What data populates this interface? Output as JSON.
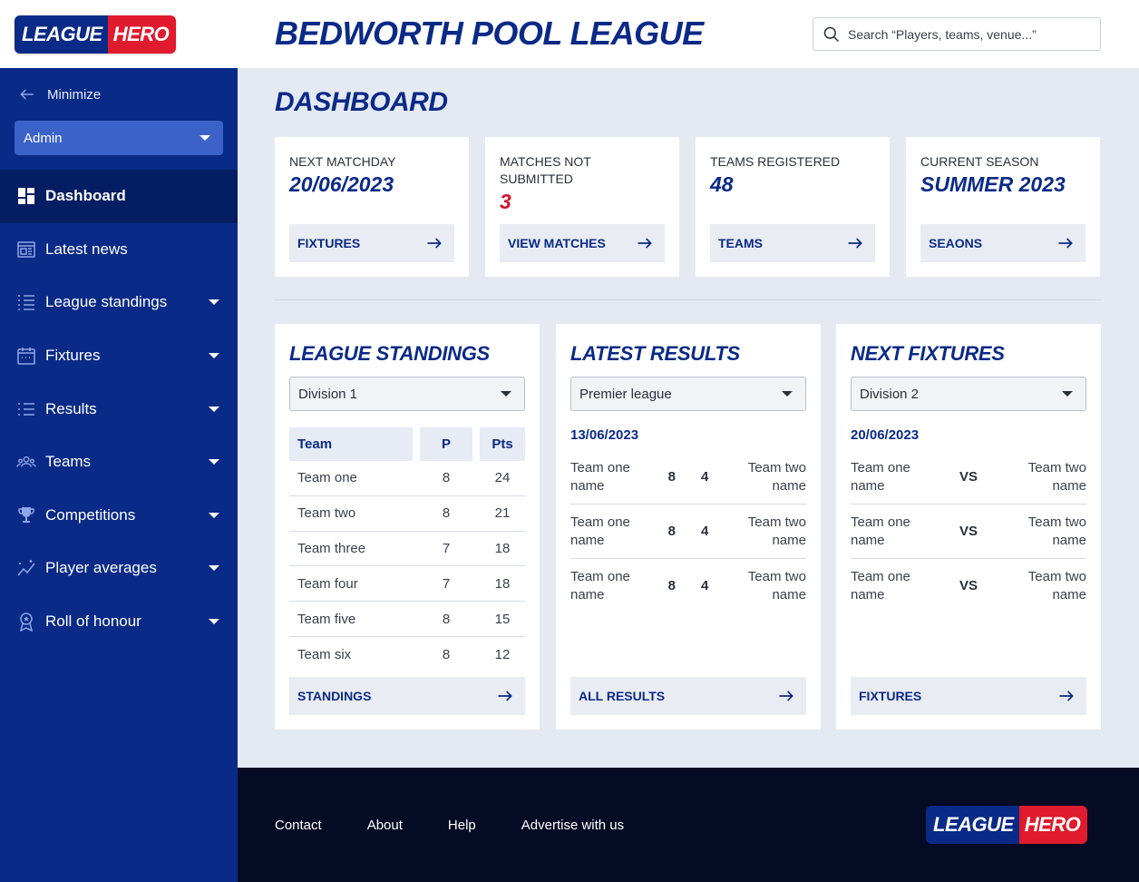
{
  "brand": {
    "part1": "LEAGUE",
    "part2": "HERO"
  },
  "header": {
    "title": "BEDWORTH POOL LEAGUE",
    "search_placeholder": "Search “Players, teams, venue...”"
  },
  "sidebar": {
    "minimize_label": "Minimize",
    "role": "Admin",
    "items": [
      {
        "label": "Dashboard",
        "icon": "dashboard-icon"
      },
      {
        "label": "Latest news",
        "icon": "news-icon"
      },
      {
        "label": "League standings",
        "icon": "standings-icon"
      },
      {
        "label": "Fixtures",
        "icon": "calendar-icon"
      },
      {
        "label": "Results",
        "icon": "list-icon"
      },
      {
        "label": "Teams",
        "icon": "teams-icon"
      },
      {
        "label": "Competitions",
        "icon": "trophy-icon"
      },
      {
        "label": "Player averages",
        "icon": "chart-sparkle-icon"
      },
      {
        "label": "Roll of honour",
        "icon": "medal-icon"
      }
    ]
  },
  "page": {
    "title": "DASHBOARD"
  },
  "stats": [
    {
      "label": "NEXT MATCHDAY",
      "value": "20/06/2023",
      "button": "FIXTURES"
    },
    {
      "label": "MATCHES NOT SUBMITTED",
      "value": "3",
      "button": "VIEW MATCHES"
    },
    {
      "label": "TEAMS REGISTERED",
      "value": "48",
      "button": "TEAMS"
    },
    {
      "label": "CURRENT SEASON",
      "value": "SUMMER 2023",
      "button": "SEAONS"
    }
  ],
  "standings": {
    "title": "LEAGUE STANDINGS",
    "division": "Division 1",
    "headers": {
      "team": "Team",
      "played": "P",
      "points": "Pts"
    },
    "rows": [
      {
        "team": "Team one",
        "p": "8",
        "pts": "24"
      },
      {
        "team": "Team two",
        "p": "8",
        "pts": "21"
      },
      {
        "team": "Team three",
        "p": "7",
        "pts": "18"
      },
      {
        "team": "Team four",
        "p": "7",
        "pts": "18"
      },
      {
        "team": "Team five",
        "p": "8",
        "pts": "15"
      },
      {
        "team": "Team six",
        "p": "8",
        "pts": "12"
      }
    ],
    "button": "STANDINGS"
  },
  "results": {
    "title": "LATEST RESULTS",
    "league": "Premier league",
    "date": "13/06/2023",
    "matches": [
      {
        "home": "Team one name",
        "home_score": "8",
        "away_score": "4",
        "away": "Team two name"
      },
      {
        "home": "Team one name",
        "home_score": "8",
        "away_score": "4",
        "away": "Team two name"
      },
      {
        "home": "Team one name",
        "home_score": "8",
        "away_score": "4",
        "away": "Team two name"
      }
    ],
    "button": "ALL RESULTS"
  },
  "fixtures": {
    "title": "NEXT FIXTURES",
    "division": "Division 2",
    "date": "20/06/2023",
    "vs_label": "VS",
    "matches": [
      {
        "home": "Team one name",
        "away": "Team two name"
      },
      {
        "home": "Team one name",
        "away": "Team two name"
      },
      {
        "home": "Team one name",
        "away": "Team two name"
      }
    ],
    "button": "FIXTURES"
  },
  "footer": {
    "links": [
      "Contact",
      "About",
      "Help",
      "Advertise with us"
    ]
  },
  "colors": {
    "primary": "#0a2a87",
    "accent": "#e01b2d",
    "footer": "#050b24",
    "background": "#e4e9f2"
  }
}
